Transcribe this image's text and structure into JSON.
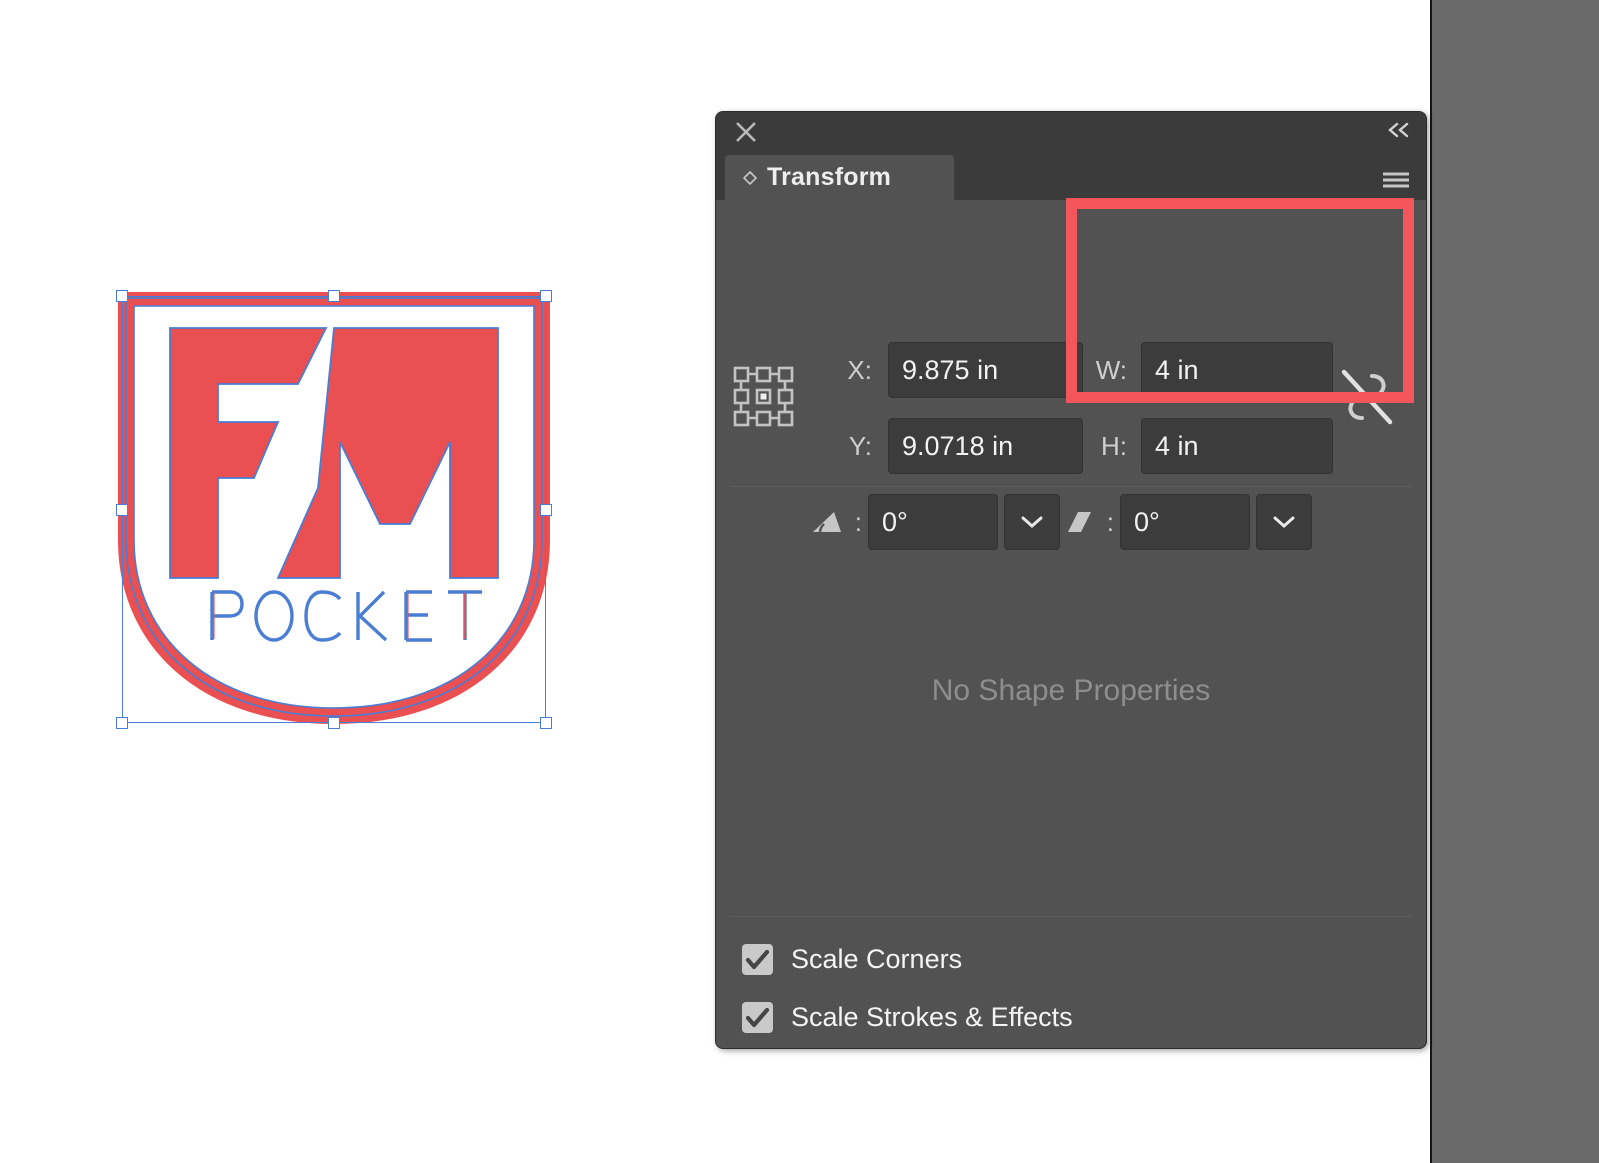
{
  "app": {
    "canvas_background": "#ffffff",
    "outside_canvas_color": "#6a6a6a"
  },
  "panel": {
    "title": "Transform",
    "close_icon": "close-icon",
    "collapse_icon": "collapse-double-chevron-icon",
    "menu_icon": "panel-menu-hamburger-icon",
    "tab_icon": "transform-diamond-icon",
    "reference_point_icon": "reference-point-grid-icon",
    "link_icon": "constrain-proportions-unlinked-icon",
    "fields": [
      {
        "id": "x",
        "label": "X:",
        "value": "9.875 in"
      },
      {
        "id": "y",
        "label": "Y:",
        "value": "9.0718 in"
      },
      {
        "id": "w",
        "label": "W:",
        "value": "4 in"
      },
      {
        "id": "h",
        "label": "H:",
        "value": "4 in"
      },
      {
        "id": "rotate",
        "label": "",
        "icon": "rotate-angle-icon",
        "value": "0°",
        "has_stepper": true
      },
      {
        "id": "shear",
        "label": "",
        "icon": "shear-parallelogram-icon",
        "value": "0°",
        "has_stepper": true
      }
    ],
    "rotate_colon": ":",
    "shear_colon": ":",
    "no_shape_properties": "No Shape Properties",
    "checkboxes": [
      {
        "label": "Scale Corners",
        "checked": true
      },
      {
        "label": "Scale Strokes & Effects",
        "checked": true
      }
    ]
  },
  "annotation": {
    "name": "width-height-highlight",
    "color": "#f4565c",
    "note": "red rectangle highlighting W and H fields"
  },
  "artwork": {
    "name": "fm-pocket-shield-logo",
    "letters": "FM",
    "wordmark": "POCKET",
    "fill_color": "#ea4f52",
    "selection_path_color": "#4a7dd4",
    "selected": true
  }
}
